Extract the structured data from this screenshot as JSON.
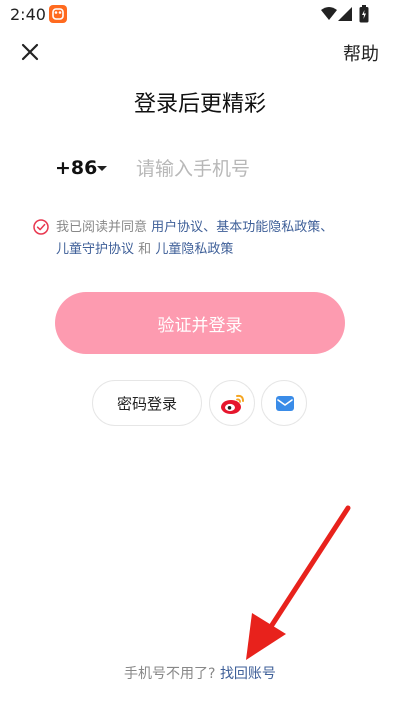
{
  "status_bar": {
    "time": "2:40",
    "icons": [
      "notification-app-icon",
      "wifi-icon",
      "signal-icon",
      "battery-icon"
    ]
  },
  "header": {
    "close_icon": "close-icon",
    "help_label": "帮助"
  },
  "title": "登录后更精彩",
  "phone": {
    "country_code": "+86",
    "placeholder": "请输入手机号",
    "value": ""
  },
  "agreement": {
    "checked": true,
    "prefix": "我已阅读并同意",
    "user_agreement": "用户协议",
    "sep1": "、",
    "basic_privacy": "基本功能隐私政策",
    "sep2": "、",
    "child_protection": "儿童守护协议",
    "and": "和",
    "child_privacy": "儿童隐私政策"
  },
  "submit_label": "验证并登录",
  "alt_login": {
    "password_label": "密码登录",
    "weibo_icon": "weibo-icon",
    "email_icon": "email-icon"
  },
  "footer": {
    "label": "手机号不用了?",
    "link": "找回账号"
  },
  "colors": {
    "accent_pink": "#fd9bb0",
    "link_blue": "#3e5f98",
    "annotation_red": "#e8221c",
    "check_red": "#e8374f"
  }
}
